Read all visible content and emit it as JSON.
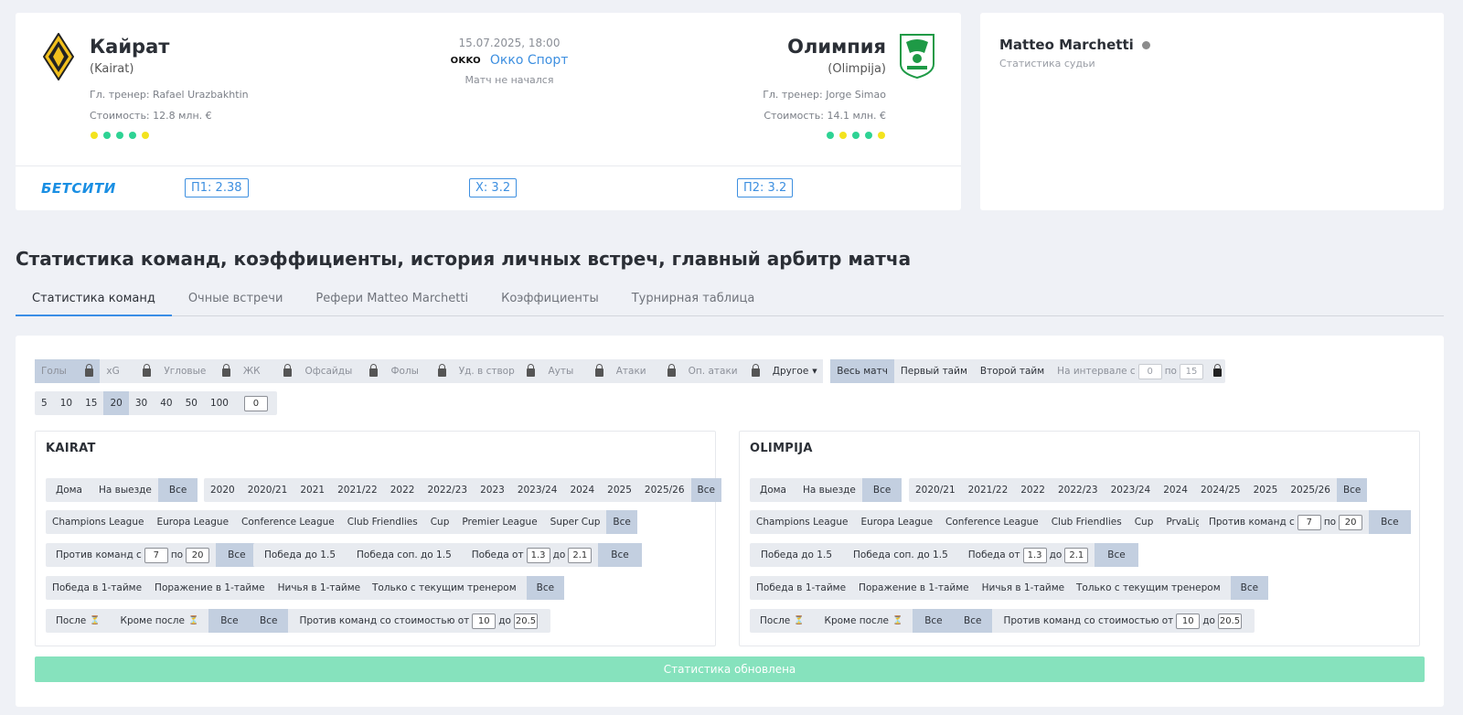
{
  "match": {
    "home": {
      "name": "Кайрат",
      "latin": "(Kairat)",
      "coach": "Гл. тренер: Rafael Urazbakhtin",
      "value": "Стоимость: 12.8 млн. €",
      "form_colors": [
        "#f3e31e",
        "#2ed394",
        "#2ed394",
        "#2ed394",
        "#f3e31e"
      ]
    },
    "away": {
      "name": "Олимпия",
      "latin": "(Olimpija)",
      "coach": "Гл. тренер: Jorge Simao",
      "value": "Стоимость: 14.1 млн. €",
      "form_colors": [
        "#2ed394",
        "#f3e31e",
        "#2ed394",
        "#2ed394",
        "#f3e31e"
      ]
    },
    "date": "15.07.2025, 18:00",
    "broadcaster_logo": "OKKO",
    "broadcaster": "Окко Спорт",
    "status": "Матч не начался",
    "bookmaker": "БЕТСИТИ",
    "odds": {
      "p1": "П1: 2.38",
      "x": "X: 3.2",
      "p2": "П2: 3.2"
    }
  },
  "referee": {
    "name": "Matteo Marchetti",
    "subtitle": "Статистика судьи"
  },
  "section_title": "Статистика команд, коэффициенты, история личных встреч, главный арбитр матча",
  "tabs": [
    "Статистика команд",
    "Очные встречи",
    "Рефери Matteo Marchetti",
    "Коэффициенты",
    "Турнирная таблица"
  ],
  "stat_types": [
    "Голы",
    "xG",
    "Угловые",
    "ЖК",
    "Офсайды",
    "Фолы",
    "Уд. в створ",
    "Ауты",
    "Атаки",
    "Оп. атаки"
  ],
  "other_label": "Другое",
  "periods": [
    "Весь матч",
    "Первый тайм",
    "Второй тайм"
  ],
  "interval": {
    "label": "На интервале с",
    "from": "0",
    "sep": "по",
    "to": "15"
  },
  "last_n": [
    "5",
    "10",
    "15",
    "20",
    "30",
    "40",
    "50",
    "100"
  ],
  "last_n_custom": "0",
  "filters": {
    "home_label": "Дома",
    "away_label": "На выезде",
    "all": "Все",
    "vs_teams": "Против команд с",
    "from_to": "по",
    "win_to": "Победа до 1.5",
    "opp_win_to": "Победа соп. до 1.5",
    "win_from": "Победа от",
    "to": "до",
    "odd_from": "1.3",
    "odd_to": "2.1",
    "win_1h": "Победа в 1-тайме",
    "lose_1h": "Поражение в 1-тайме",
    "draw_1h": "Ничья в 1-тайме",
    "current_coach": "Только с текущим тренером",
    "after": "После",
    "except_after": "Кроме после",
    "vs_value": "Против команд со стоимостью от",
    "value_from": "10",
    "value_to": "20.5",
    "rank_from": "7",
    "rank_to": "20"
  },
  "kairat": {
    "title": "KAIRAT",
    "seasons": [
      "2020",
      "2020/21",
      "2021",
      "2021/22",
      "2022",
      "2022/23",
      "2023",
      "2023/24",
      "2024",
      "2025",
      "2025/26"
    ],
    "tournaments": [
      "Champions League",
      "Europa League",
      "Conference League",
      "Club Friendlies",
      "Cup",
      "Premier League",
      "Super Cup"
    ]
  },
  "olimpija": {
    "title": "OLIMPIJA",
    "seasons": [
      "2020/21",
      "2021/22",
      "2022",
      "2022/23",
      "2023/24",
      "2024",
      "2024/25",
      "2025",
      "2025/26"
    ],
    "tournaments": [
      "Champions League",
      "Europa League",
      "Conference League",
      "Club Friendlies",
      "Cup",
      "PrvaLiga"
    ]
  },
  "update_status": "Статистика обновлена"
}
